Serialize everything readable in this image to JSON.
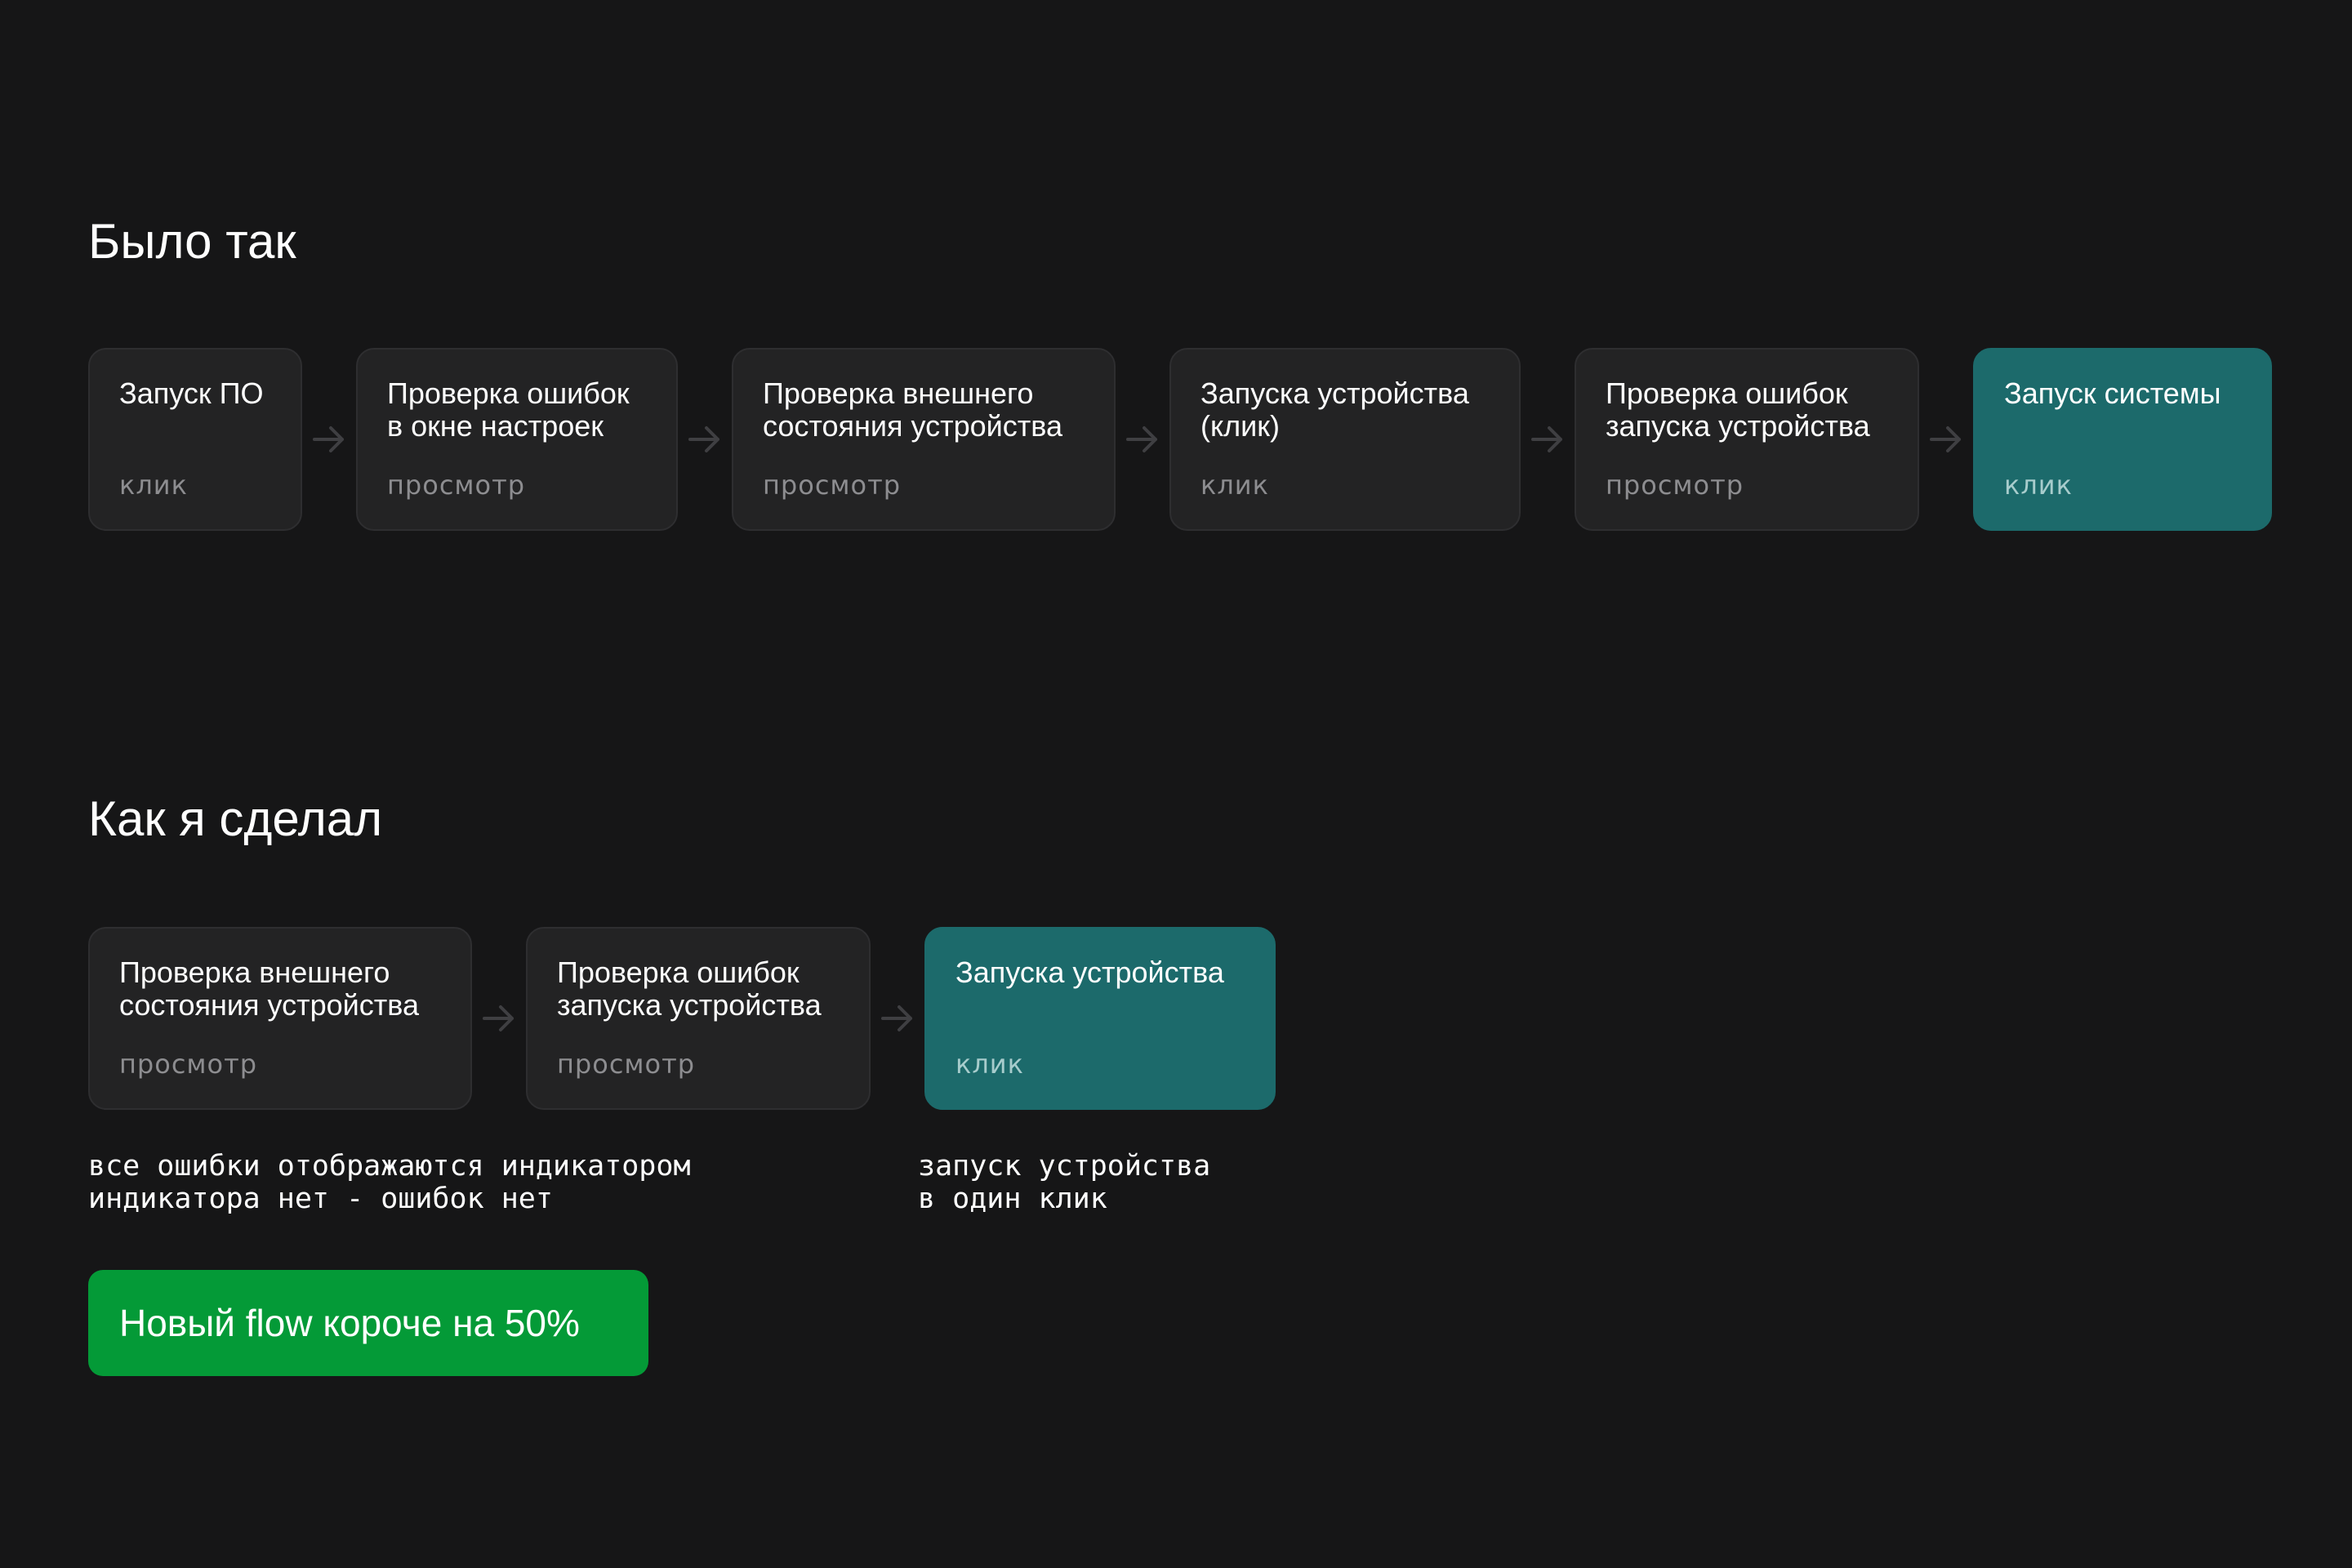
{
  "before": {
    "title": "Было так",
    "steps": [
      {
        "title": "Запуск ПО",
        "action": "клик",
        "accent": false
      },
      {
        "title": "Проверка ошибок\nв окне настроек",
        "action": "просмотр",
        "accent": false
      },
      {
        "title": "Проверка  внешнего\nсостояния устройства",
        "action": "просмотр",
        "accent": false
      },
      {
        "title": "Запуска устройства\n(клик)",
        "action": "клик",
        "accent": false
      },
      {
        "title": "Проверка ошибок\nзапуска устройства",
        "action": "просмотр",
        "accent": false
      },
      {
        "title": "Запуск системы",
        "action": "клик",
        "accent": true
      }
    ]
  },
  "after": {
    "title": "Как я сделал",
    "steps": [
      {
        "title": "Проверка  внешнего\nсостояния устройства",
        "action": "просмотр",
        "accent": false
      },
      {
        "title": "Проверка ошибок\nзапуска устройства",
        "action": "просмотр",
        "accent": false
      },
      {
        "title": "Запуска устройства",
        "action": "клик",
        "accent": true
      }
    ],
    "note_left": "все ошибки отображаются индикатором\nиндикатора нет - ошибок нет",
    "note_right": "запуск устройства\nв один клик"
  },
  "result": {
    "label": "Новый flow короче на 50%"
  },
  "colors": {
    "background": "#161617",
    "card": "#232324",
    "card_border": "#2e2e30",
    "accent_card": "#1c6a6b",
    "result_badge": "#049a37",
    "arrow": "#3f3f42",
    "muted_text": "#8d8d90"
  }
}
